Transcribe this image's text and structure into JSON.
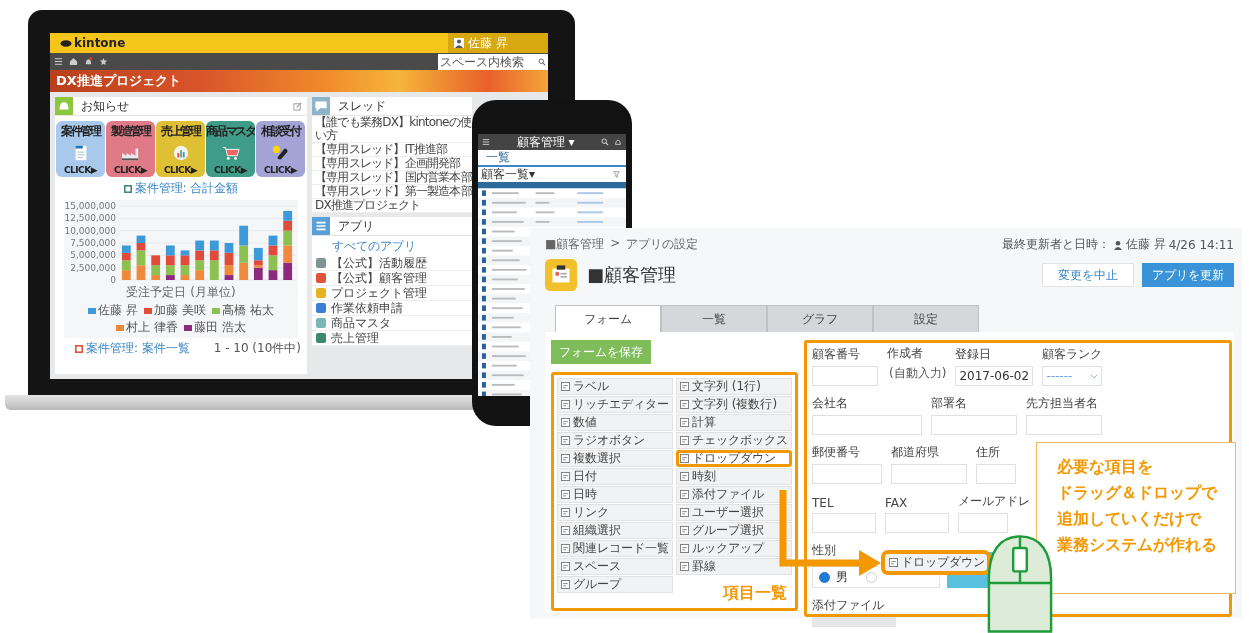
{
  "laptop": {
    "logo": "kintone",
    "user": "佐藤 昇",
    "search": {
      "placeholder": "スペース内検索"
    },
    "space_title": "DX推進プロジェクト",
    "notice": {
      "title": "お知らせ",
      "tiles": [
        {
          "label": "案件管理",
          "action": "CLICK▶",
          "color": "#a9c9ec",
          "kind": "document"
        },
        {
          "label": "製造管理",
          "action": "CLICK▶",
          "color": "#df7a86",
          "kind": "factory"
        },
        {
          "label": "売上管理",
          "action": "CLICK▶",
          "color": "#dfbf34",
          "kind": "chart"
        },
        {
          "label": "商品マスタ",
          "action": "CLICK▶",
          "color": "#3f9c88",
          "kind": "cart"
        },
        {
          "label": "相談受付",
          "action": "CLICK▶",
          "color": "#a3a3d6",
          "kind": "phone"
        }
      ],
      "chart_link": "案件管理: 合計金額",
      "chart_data": {
        "type": "bar",
        "stacked": true,
        "grid": true,
        "legend": "bottom",
        "xlabel": "受注予定日 (月単位)",
        "yticks": [
          {
            "value": 0,
            "label": "0"
          },
          {
            "value": 2500000,
            "label": "2,500,000"
          },
          {
            "value": 5000000,
            "label": "5,000,000"
          },
          {
            "value": 7500000,
            "label": "7,500,000"
          },
          {
            "value": 10000000,
            "label": "10,000,000"
          },
          {
            "value": 12500000,
            "label": "12,500,000"
          },
          {
            "value": 15000000,
            "label": "15,000,000"
          }
        ],
        "ylim": [
          0,
          15000000
        ],
        "series": [
          {
            "name": "佐藤 昇",
            "color": "#3d9ad9",
            "values": [
              1500000,
              1500000,
              0,
              2000000,
              1000000,
              2000000,
              2000000,
              2000000,
              4000000,
              2500000,
              2000000,
              2000000
            ]
          },
          {
            "name": "加藤 美咲",
            "color": "#e04b3c",
            "values": [
              1500000,
              1500000,
              2000000,
              2000000,
              2000000,
              2000000,
              2000000,
              2500000,
              0,
              1000000,
              2000000,
              2000000
            ]
          },
          {
            "name": "高橋 祐太",
            "color": "#8cc152",
            "values": [
              2000000,
              3000000,
              2000000,
              2000000,
              2000000,
              2000000,
              4000000,
              0,
              3500000,
              0,
              3000000,
              3000000
            ]
          },
          {
            "name": "村上 律香",
            "color": "#ef8a3c",
            "values": [
              2000000,
              3000000,
              1000000,
              0,
              1000000,
              2000000,
              0,
              2000000,
              3500000,
              500000,
              0,
              3500000
            ]
          },
          {
            "name": "藤田 浩太",
            "color": "#8e2a7e",
            "values": [
              0,
              0,
              0,
              1000000,
              0,
              0,
              0,
              1000000,
              0,
              2500000,
              2000000,
              3500000
            ]
          }
        ]
      },
      "list_link": "案件管理: 案件一覧",
      "count": "1 - 10 (10件中)"
    },
    "threads": {
      "title": "スレッド",
      "items": [
        "【誰でも業務DX】kintoneの使い方",
        "【専用スレッド】IT推進部",
        "【専用スレッド】企画開発部",
        "【専用スレッド】国内営業本部",
        "【専用スレッド】第一製造本部",
        "DX推進プロジェクト"
      ]
    },
    "apps": {
      "title": "アプリ",
      "all_link": "すべてのアプリ",
      "items": [
        {
          "label": "【公式】活動履歴",
          "color": "#7f9494"
        },
        {
          "label": "【公式】顧客管理",
          "color": "#e0553a"
        },
        {
          "label": "プロジェクト管理",
          "color": "#e6b422"
        },
        {
          "label": "作業依頼申請",
          "color": "#3b7ed6"
        },
        {
          "label": "商品マスタ",
          "color": "#79b7b7"
        },
        {
          "label": "売上管理",
          "color": "#3c8a6c"
        }
      ]
    }
  },
  "phone": {
    "app_name": "顧客管理 ▾",
    "tab": "一覧",
    "view": "顧客一覧▾"
  },
  "form_editor": {
    "breadcrumb": {
      "items": [
        "■顧客管理",
        "アプリの設定"
      ],
      "separator": ">"
    },
    "updated": {
      "label": "最終更新者と日時：",
      "user": "佐藤 昇",
      "time": "4/26 14:11"
    },
    "title": "■顧客管理",
    "buttons": [
      {
        "label": "変更を中止",
        "kind": "secondary"
      },
      {
        "label": "アプリを更新",
        "kind": "primary"
      }
    ],
    "tabs": [
      {
        "label": "フォーム",
        "selected": true
      },
      {
        "label": "一覧",
        "selected": false
      },
      {
        "label": "グラフ",
        "selected": false
      },
      {
        "label": "設定",
        "selected": false
      }
    ],
    "save_button": "フォームを保存",
    "palette": {
      "title": "項目一覧",
      "items": [
        {
          "label": "ラベル",
          "selected": false
        },
        {
          "label": "文字列 (1行)",
          "selected": false
        },
        {
          "label": "リッチエディター",
          "selected": false
        },
        {
          "label": "文字列 (複数行)",
          "selected": false
        },
        {
          "label": "数値",
          "selected": false
        },
        {
          "label": "計算",
          "selected": false
        },
        {
          "label": "ラジオボタン",
          "selected": false
        },
        {
          "label": "チェックボックス",
          "selected": false
        },
        {
          "label": "複数選択",
          "selected": false
        },
        {
          "label": "ドロップダウン",
          "selected": true
        },
        {
          "label": "日付",
          "selected": false
        },
        {
          "label": "時刻",
          "selected": false
        },
        {
          "label": "日時",
          "selected": false
        },
        {
          "label": "添付ファイル",
          "selected": false
        },
        {
          "label": "リンク",
          "selected": false
        },
        {
          "label": "ユーザー選択",
          "selected": false
        },
        {
          "label": "組織選択",
          "selected": false
        },
        {
          "label": "グループ選択",
          "selected": false
        },
        {
          "label": "関連レコード一覧",
          "selected": false
        },
        {
          "label": "ルックアップ",
          "selected": false
        },
        {
          "label": "スペース",
          "selected": false
        },
        {
          "label": "罫線",
          "selected": false
        },
        {
          "label": "グループ",
          "selected": false
        }
      ]
    },
    "fields": [
      [
        {
          "label": "顧客番号",
          "kind": "text"
        },
        {
          "label": "作成者",
          "kind": "auto",
          "value": "(自動入力)"
        },
        {
          "label": "登録日",
          "kind": "date",
          "value": "2017-06-02"
        },
        {
          "label": "顧客ランク",
          "kind": "select",
          "value": "------"
        }
      ],
      [
        {
          "label": "会社名",
          "kind": "text"
        },
        {
          "label": "部署名",
          "kind": "text"
        },
        {
          "label": "先方担当者名",
          "kind": "text"
        }
      ],
      [
        {
          "label": "郵便番号",
          "kind": "text"
        },
        {
          "label": "都道府県",
          "kind": "text"
        },
        {
          "label": "住所",
          "kind": "text"
        }
      ],
      [
        {
          "label": "TEL",
          "kind": "text"
        },
        {
          "label": "FAX",
          "kind": "text"
        },
        {
          "label": "メールアドレ",
          "kind": "text"
        }
      ]
    ],
    "radio": {
      "label": "性別",
      "options": [
        {
          "label": "男",
          "selected": true
        },
        {
          "selected": false
        }
      ]
    },
    "dropped_item": "ドロップダウン",
    "attachment": {
      "label": "添付ファイル"
    },
    "callout": {
      "lines": [
        "必要な項目を",
        "ドラッグ＆ドロップで",
        "追加していくだけで",
        "業務システムが作れる"
      ]
    }
  }
}
